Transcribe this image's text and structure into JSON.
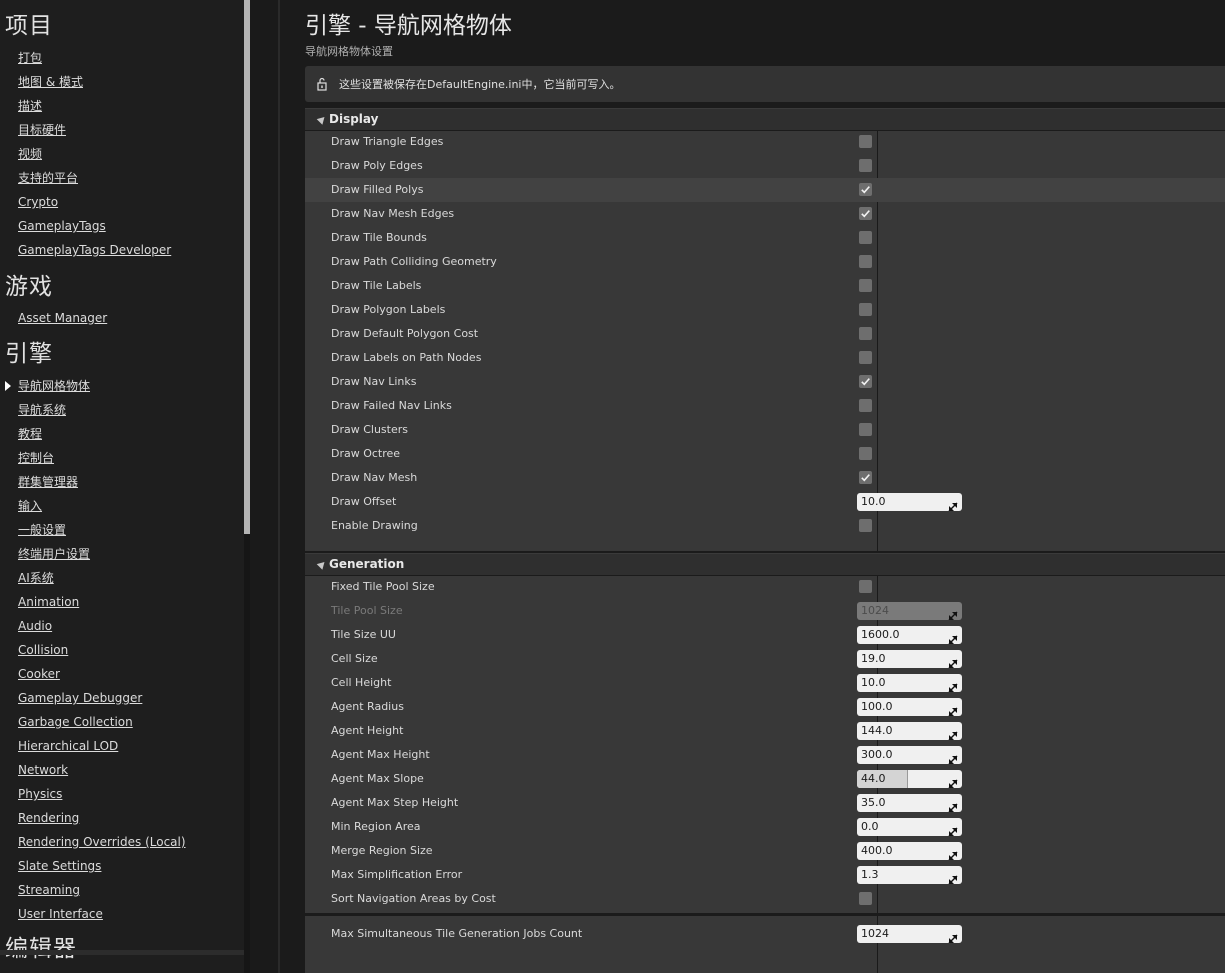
{
  "sidebar": {
    "categories": [
      {
        "title": "项目",
        "items": [
          "打包",
          "地图 & 模式",
          "描述",
          "目标硬件",
          "视频",
          "支持的平台",
          "Crypto",
          "GameplayTags",
          "GameplayTags Developer"
        ]
      },
      {
        "title": "游戏",
        "items": [
          "Asset Manager"
        ]
      },
      {
        "title": "引擎",
        "items": [
          "导航网格物体",
          "导航系统",
          "教程",
          "控制台",
          "群集管理器",
          "输入",
          "一般设置",
          "终端用户设置",
          "AI系统",
          "Animation",
          "Audio",
          "Collision",
          "Cooker",
          "Gameplay Debugger",
          "Garbage Collection",
          "Hierarchical LOD",
          "Network",
          "Physics",
          "Rendering",
          "Rendering Overrides (Local)",
          "Slate Settings",
          "Streaming",
          "User Interface"
        ]
      },
      {
        "title": "编辑器",
        "items": []
      }
    ],
    "active_item": "导航网格物体"
  },
  "header": {
    "title": "引擎 - 导航网格物体",
    "subtitle": "导航网格物体设置"
  },
  "notice": {
    "icon": "lock-icon",
    "text": "这些设置被保存在DefaultEngine.ini中，它当前可写入。"
  },
  "sections": {
    "display": {
      "title": "Display",
      "rows": [
        {
          "label": "Draw Triangle Edges",
          "type": "checkbox",
          "checked": false
        },
        {
          "label": "Draw Poly Edges",
          "type": "checkbox",
          "checked": false
        },
        {
          "label": "Draw Filled Polys",
          "type": "checkbox",
          "checked": true
        },
        {
          "label": "Draw Nav Mesh Edges",
          "type": "checkbox",
          "checked": true
        },
        {
          "label": "Draw Tile Bounds",
          "type": "checkbox",
          "checked": false
        },
        {
          "label": "Draw Path Colliding Geometry",
          "type": "checkbox",
          "checked": false
        },
        {
          "label": "Draw Tile Labels",
          "type": "checkbox",
          "checked": false
        },
        {
          "label": "Draw Polygon Labels",
          "type": "checkbox",
          "checked": false
        },
        {
          "label": "Draw Default Polygon Cost",
          "type": "checkbox",
          "checked": false
        },
        {
          "label": "Draw Labels on Path Nodes",
          "type": "checkbox",
          "checked": false
        },
        {
          "label": "Draw Nav Links",
          "type": "checkbox",
          "checked": true
        },
        {
          "label": "Draw Failed Nav Links",
          "type": "checkbox",
          "checked": false
        },
        {
          "label": "Draw Clusters",
          "type": "checkbox",
          "checked": false
        },
        {
          "label": "Draw Octree",
          "type": "checkbox",
          "checked": false
        },
        {
          "label": "Draw Nav Mesh",
          "type": "checkbox",
          "checked": true
        },
        {
          "label": "Draw Offset",
          "type": "number",
          "value": "10.0"
        },
        {
          "label": "Enable Drawing",
          "type": "checkbox",
          "checked": false
        }
      ]
    },
    "generation": {
      "title": "Generation",
      "rows": [
        {
          "label": "Fixed Tile Pool Size",
          "type": "checkbox",
          "checked": false
        },
        {
          "label": "Tile Pool Size",
          "type": "number",
          "value": "1024",
          "disabled": true
        },
        {
          "label": "Tile Size UU",
          "type": "number",
          "value": "1600.0"
        },
        {
          "label": "Cell Size",
          "type": "number",
          "value": "19.0"
        },
        {
          "label": "Cell Height",
          "type": "number",
          "value": "10.0"
        },
        {
          "label": "Agent Radius",
          "type": "number",
          "value": "100.0"
        },
        {
          "label": "Agent Height",
          "type": "number",
          "value": "144.0"
        },
        {
          "label": "Agent Max Height",
          "type": "number",
          "value": "300.0"
        },
        {
          "label": "Agent Max Slope",
          "type": "number",
          "value": "44.0",
          "slider_fraction": 0.489
        },
        {
          "label": "Agent Max Step Height",
          "type": "number",
          "value": "35.0"
        },
        {
          "label": "Min Region Area",
          "type": "number",
          "value": "0.0"
        },
        {
          "label": "Merge Region Size",
          "type": "number",
          "value": "400.0"
        },
        {
          "label": "Max Simplification Error",
          "type": "number",
          "value": "1.3"
        },
        {
          "label": "Sort Navigation Areas by Cost",
          "type": "checkbox",
          "checked": false
        }
      ]
    },
    "advanced": {
      "rows": [
        {
          "label": "Max Simultaneous Tile Generation Jobs Count",
          "type": "number",
          "value": "1024"
        }
      ]
    }
  },
  "colors": {
    "background": "#1b1b1b",
    "panel": "#383838",
    "header": "#2f2f2f",
    "checkbox": "#6e6e6e",
    "field": "#f0f0f0"
  }
}
